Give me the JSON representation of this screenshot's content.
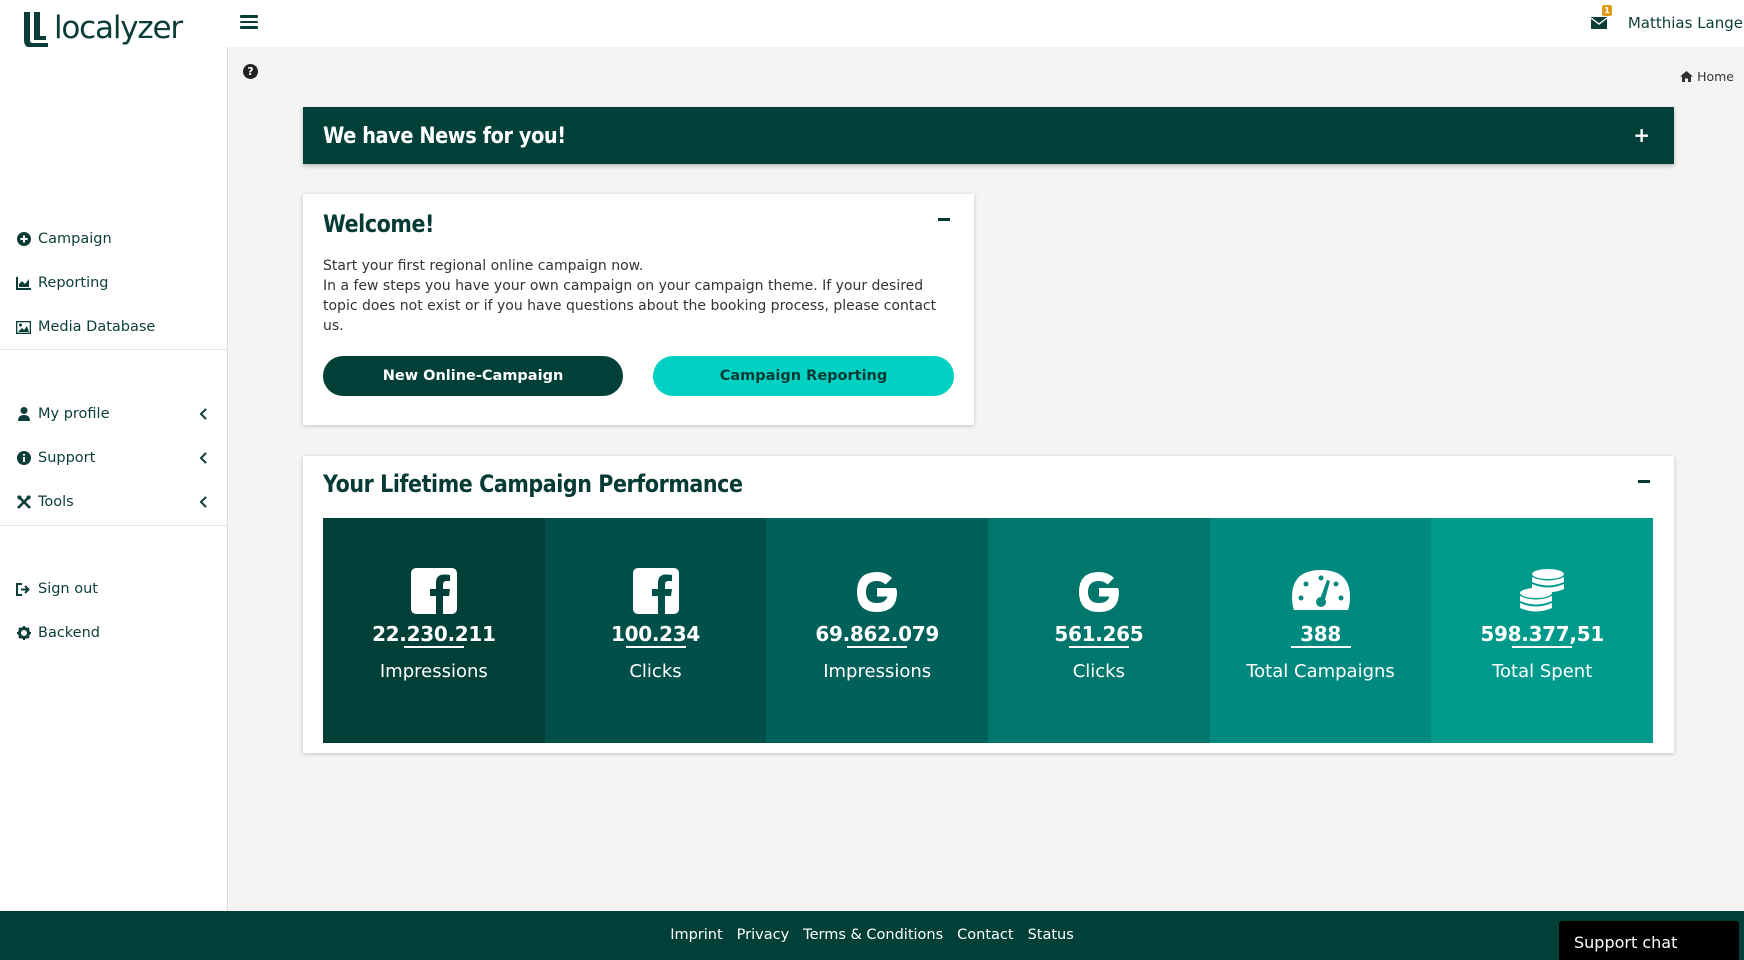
{
  "app": {
    "logo_text": "localyzer"
  },
  "header": {
    "notification_count": "1",
    "user_name": "Matthias Lange"
  },
  "sidebar": {
    "items": [
      {
        "label": "Campaign",
        "icon": "plus-circle-icon"
      },
      {
        "label": "Reporting",
        "icon": "area-chart-icon"
      },
      {
        "label": "Media Database",
        "icon": "image-icon"
      },
      {
        "label": "My profile",
        "icon": "user-icon",
        "expandable": true
      },
      {
        "label": "Support",
        "icon": "info-circle-icon",
        "expandable": true
      },
      {
        "label": "Tools",
        "icon": "tools-icon",
        "expandable": true
      },
      {
        "label": "Sign out",
        "icon": "sign-out-icon"
      },
      {
        "label": "Backend",
        "icon": "gear-icon"
      }
    ]
  },
  "breadcrumb": {
    "home": "Home"
  },
  "news": {
    "title": "We have News for you!"
  },
  "welcome": {
    "title": "Welcome!",
    "line1": "Start your first regional online campaign now.",
    "line2": "In a few steps you have your own campaign on your campaign theme. If your desired topic does not exist or if you have questions about the booking process, please contact us.",
    "btn_new": "New Online-Campaign",
    "btn_reporting": "Campaign Reporting"
  },
  "performance": {
    "title": "Your Lifetime Campaign Performance",
    "tiles": [
      {
        "icon": "facebook-icon",
        "value": "22.230.211",
        "label": "Impressions",
        "color": "#004039"
      },
      {
        "icon": "facebook-icon",
        "value": "100.234",
        "label": "Clicks",
        "color": "#005049"
      },
      {
        "icon": "google-icon",
        "value": "69.862.079",
        "label": "Impressions",
        "color": "#00605a"
      },
      {
        "icon": "google-icon",
        "value": "561.265",
        "label": "Clicks",
        "color": "#00766d"
      },
      {
        "icon": "dashboard-icon",
        "value": "388",
        "label": "Total Campaigns",
        "color": "#008a7f"
      },
      {
        "icon": "coins-icon",
        "value": "598.377,51",
        "label": "Total Spent",
        "color": "#009a8c"
      }
    ]
  },
  "footer": {
    "links": [
      "Imprint",
      "Privacy",
      "Terms & Conditions",
      "Contact",
      "Status"
    ]
  },
  "support_chat": {
    "label": "Support chat"
  }
}
